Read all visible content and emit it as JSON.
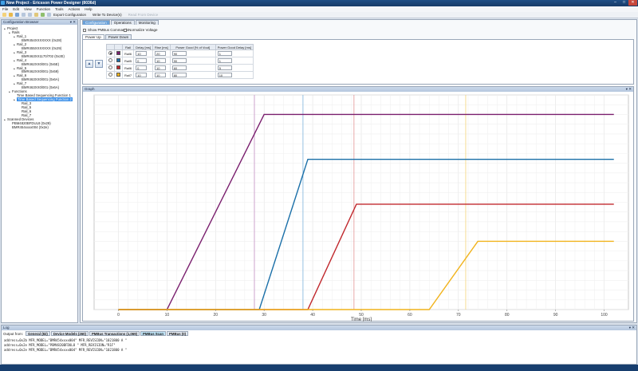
{
  "window": {
    "title": "New Project - Ericsson Power Designer (8036d)",
    "minimize": "–",
    "maximize": "□",
    "close": "✕"
  },
  "menu": [
    "File",
    "Edit",
    "View",
    "Function",
    "Tools",
    "Actions",
    "Help"
  ],
  "toolbar": {
    "export_label": "Export Configuration",
    "write_label": "Write To Device(s)",
    "read_label": "Read From Device"
  },
  "config_browser": {
    "title": "Configuration Browser",
    "pin": "▾ ✕",
    "tree": [
      {
        "text": "Project",
        "level": 0,
        "exp": "▴"
      },
      {
        "text": "Rails",
        "level": 1,
        "exp": "▴"
      },
      {
        "text": "Rail_1",
        "level": 2,
        "exp": "▴"
      },
      {
        "text": "BMR454XXXXXXX (0x28)",
        "level": 3,
        "exp": ""
      },
      {
        "text": "Rail_2",
        "level": 2,
        "exp": "▴"
      },
      {
        "text": "BMR455XXXXXXX (0x29)",
        "level": 3,
        "exp": ""
      },
      {
        "text": "Rail_3",
        "level": 2,
        "exp": "▴"
      },
      {
        "text": "BMR463XX1170/702 (0x2E)",
        "level": 3,
        "exp": ""
      },
      {
        "text": "Rail_4",
        "level": 2,
        "exp": "▴"
      },
      {
        "text": "BMR462XX0/001 (0x5E)",
        "level": 3,
        "exp": ""
      },
      {
        "text": "Rail_5",
        "level": 2,
        "exp": "▴"
      },
      {
        "text": "BMR462XX0/001 (0x59)",
        "level": 3,
        "exp": ""
      },
      {
        "text": "Rail_6",
        "level": 2,
        "exp": "▴"
      },
      {
        "text": "BMR463XX0/001 (0x6A)",
        "level": 3,
        "exp": ""
      },
      {
        "text": "Rail_7",
        "level": 2,
        "exp": "▴"
      },
      {
        "text": "BMR463XX0/001 (0x6A)",
        "level": 3,
        "exp": ""
      },
      {
        "text": "Functions",
        "level": 1,
        "exp": "▴"
      },
      {
        "text": "Time Based Sequencing Function 1",
        "level": 2,
        "exp": ""
      },
      {
        "text": "Time Based Sequencing Function 2",
        "level": 2,
        "exp": "▴",
        "selected": true
      },
      {
        "text": "Rail_3",
        "level": 3,
        "exp": ""
      },
      {
        "text": "Rail_5",
        "level": 3,
        "exp": ""
      },
      {
        "text": "Rail_6",
        "level": 3,
        "exp": ""
      },
      {
        "text": "Rail_7",
        "level": 3,
        "exp": ""
      },
      {
        "text": "Scanned Devices",
        "level": 0,
        "exp": "▴"
      },
      {
        "text": "PBM4820BFDUL8      (0x29)",
        "level": 1,
        "exp": ""
      },
      {
        "text": "BMR454xxxx004  (0x2e)",
        "level": 1,
        "exp": ""
      }
    ]
  },
  "top_tabs": [
    "Configuration",
    "Operations",
    "Monitoring"
  ],
  "options": {
    "show_pmbus": "Show PMBus Commands",
    "normalize": "Normalize Voltage"
  },
  "sub_tabs": [
    "Power Up",
    "Power Down"
  ],
  "rails_table": {
    "headers": [
      "Rail",
      "Delay [ms]",
      "Rise [ms]",
      "Power Good [% of Vout]",
      "Power Good Delay [ms]"
    ],
    "rows": [
      {
        "selected": true,
        "color": "#7a1f6e",
        "rail": "Rail6",
        "delay": "10",
        "rise": "20",
        "pg": "90",
        "pgd": "1"
      },
      {
        "selected": false,
        "color": "#1a6fa8",
        "rail": "Rail5",
        "delay": "0",
        "rise": "10",
        "pg": "90",
        "pgd": "1"
      },
      {
        "selected": false,
        "color": "#c0282d",
        "rail": "Rail6",
        "delay": "0",
        "rise": "10",
        "pg": "60",
        "pgd": "5"
      },
      {
        "selected": false,
        "color": "#f1b31c",
        "rail": "Rail7",
        "delay": "10",
        "rise": "10",
        "pg": "80",
        "pgd": "10"
      }
    ]
  },
  "nav_buttons": {
    "up": "▲",
    "down": "▼"
  },
  "graph": {
    "title": "Graph",
    "controls": "▾ ✕"
  },
  "chart_data": {
    "type": "line",
    "xlabel": "Time [ms]",
    "ylabel": "",
    "xlim": [
      -5,
      105
    ],
    "ylim": [
      0,
      1.1
    ],
    "xticks": [
      0,
      10,
      20,
      30,
      40,
      50,
      60,
      70,
      80,
      90,
      100
    ],
    "grid": true,
    "series": [
      {
        "color": "#7a1f6e",
        "x": [
          0,
          10,
          30,
          102
        ],
        "y": [
          0,
          0,
          1,
          1
        ]
      },
      {
        "color": "#1a6fa8",
        "x": [
          0,
          29,
          39,
          102
        ],
        "y": [
          0,
          0,
          0.77,
          0.77
        ]
      },
      {
        "color": "#c0282d",
        "x": [
          0,
          39,
          49,
          102
        ],
        "y": [
          0,
          0,
          0.54,
          0.54
        ]
      },
      {
        "color": "#f1b31c",
        "x": [
          0,
          64,
          74,
          102
        ],
        "y": [
          0,
          0,
          0.35,
          0.35
        ]
      }
    ],
    "markers": [
      {
        "x": 28,
        "color": "#c48fc4"
      },
      {
        "x": 38,
        "color": "#7fb5dc"
      },
      {
        "x": 48.5,
        "color": "#e39495"
      },
      {
        "x": 71.5,
        "color": "#f4d67a"
      }
    ]
  },
  "log": {
    "title": "Log",
    "controls": "▾ ✕",
    "output_from": "Output from:",
    "tabs": [
      {
        "label": "General (82)",
        "active": false
      },
      {
        "label": "Device Models (260)",
        "active": false
      },
      {
        "label": "PMBus Transactions (1,069)",
        "active": false
      },
      {
        "label": "PMBus Scan",
        "active": true
      },
      {
        "label": "PMBus (0)",
        "active": false
      }
    ],
    "lines": [
      "address=0x2b  MFR_MODEL=\"BMR454xxxx004\"  MFR_REVISION=\"1021800 A  \"",
      "address=0x2e  MFR_MODEL=\"PBM4820BFDUL8      \"  MFR_REVISION=\"R1F\"",
      "address=0x2e  MFR_MODEL=\"BMR454xxxx004\"  MFR_REVISION=\"1021800 A  \""
    ]
  }
}
